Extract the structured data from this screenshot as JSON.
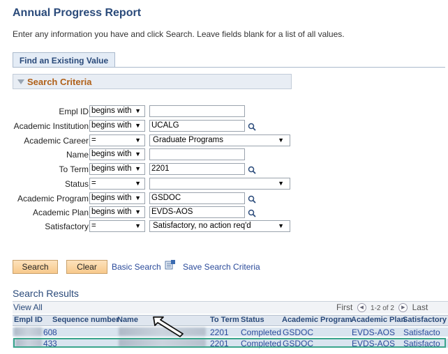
{
  "page": {
    "title": "Annual Progress Report",
    "instructions": "Enter any information you have and click Search. Leave fields blank for a list of all values."
  },
  "tab": {
    "label": "Find an Existing Value"
  },
  "criteria": {
    "header": "Search Criteria",
    "fields": [
      {
        "label": "Empl ID",
        "operator": "begins with",
        "value": ""
      },
      {
        "label": "Academic Institution",
        "operator": "begins with",
        "value": "UCALG"
      },
      {
        "label": "Academic Career",
        "operator": "=",
        "value": "Graduate Programs"
      },
      {
        "label": "Name",
        "operator": "begins with",
        "value": ""
      },
      {
        "label": "To Term",
        "operator": "begins with",
        "value": "2201"
      },
      {
        "label": "Status",
        "operator": "=",
        "value": ""
      },
      {
        "label": "Academic Program",
        "operator": "begins with",
        "value": "GSDOC"
      },
      {
        "label": "Academic Plan",
        "operator": "begins with",
        "value": "EVDS-AOS"
      },
      {
        "label": "Satisfactory",
        "operator": "=",
        "value": "Satisfactory, no action req'd"
      }
    ]
  },
  "actions": {
    "search": "Search",
    "clear": "Clear",
    "basic_search": "Basic Search",
    "save_criteria": "Save Search Criteria"
  },
  "results": {
    "title": "Search Results",
    "view_all": "View All",
    "first": "First",
    "range": "1-2 of 2",
    "last": "Last",
    "columns": [
      "Empl ID",
      "Sequence number",
      "Name",
      "To Term",
      "Status",
      "Academic Program",
      "Academic Plan",
      "Satisfactory"
    ],
    "rows": [
      {
        "empl_id": "60",
        "sequence": "8",
        "to_term": "2201",
        "status": "Completed",
        "program": "GSDOC",
        "plan": "EVDS-AOS",
        "satisfactory": "Satisfacto"
      },
      {
        "empl_id": "43",
        "sequence": "3",
        "to_term": "2201",
        "status": "Completed",
        "program": "GSDOC",
        "plan": "EVDS-AOS",
        "satisfactory": "Satisfacto"
      }
    ]
  },
  "colors": {
    "title": "#2a4a7a",
    "criteria_header": "#b06018",
    "highlight": "#3aa58c"
  }
}
